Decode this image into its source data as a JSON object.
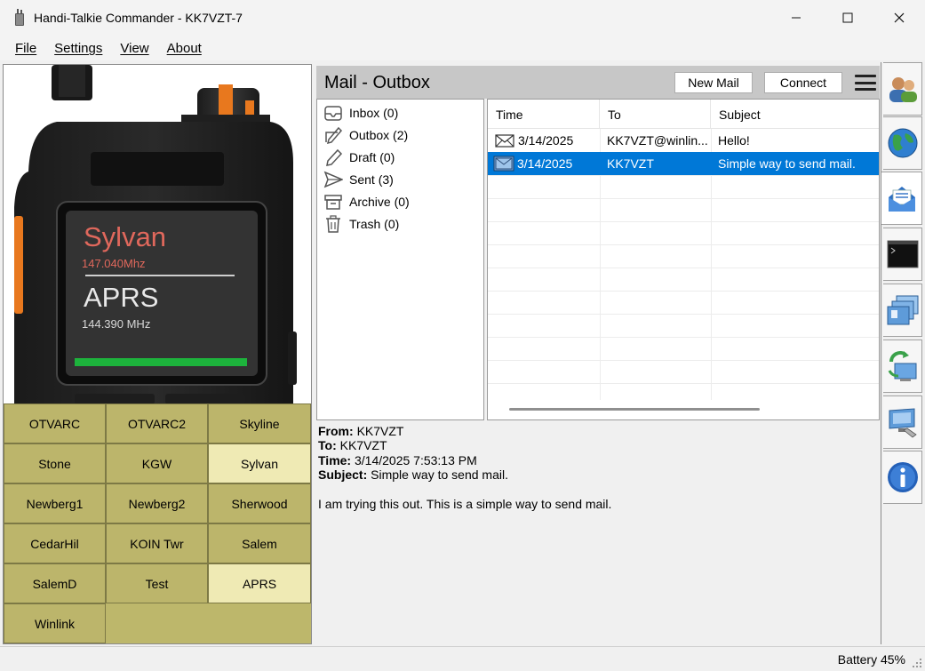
{
  "window": {
    "title": "Handi-Talkie Commander - KK7VZT-7"
  },
  "menu": [
    "File",
    "Settings",
    "View",
    "About"
  ],
  "radio": {
    "display_line1": "Sylvan",
    "display_freq1": "147.040Mhz",
    "display_line2": "APRS",
    "display_freq2": "144.390 MHz"
  },
  "channels": [
    {
      "label": "OTVARC",
      "active": false
    },
    {
      "label": "OTVARC2",
      "active": false
    },
    {
      "label": "Skyline",
      "active": false
    },
    {
      "label": "Stone",
      "active": false
    },
    {
      "label": "KGW",
      "active": false
    },
    {
      "label": "Sylvan",
      "active": true
    },
    {
      "label": "Newberg1",
      "active": false
    },
    {
      "label": "Newberg2",
      "active": false
    },
    {
      "label": "Sherwood",
      "active": false
    },
    {
      "label": "CedarHil",
      "active": false
    },
    {
      "label": "KOIN Twr",
      "active": false
    },
    {
      "label": "Salem",
      "active": false
    },
    {
      "label": "SalemD",
      "active": false
    },
    {
      "label": "Test",
      "active": false
    },
    {
      "label": "APRS",
      "active": true
    },
    {
      "label": "Winlink",
      "active": false
    }
  ],
  "mail": {
    "title": "Mail - Outbox",
    "new_mail_label": "New Mail",
    "connect_label": "Connect",
    "folders": [
      {
        "label": "Inbox (0)",
        "icon": "inbox-icon"
      },
      {
        "label": "Outbox (2)",
        "icon": "outbox-icon"
      },
      {
        "label": "Draft (0)",
        "icon": "draft-icon"
      },
      {
        "label": "Sent (3)",
        "icon": "sent-icon"
      },
      {
        "label": "Archive (0)",
        "icon": "archive-icon"
      },
      {
        "label": "Trash (0)",
        "icon": "trash-icon"
      }
    ],
    "columns": [
      "Time",
      "To",
      "Subject"
    ],
    "rows": [
      {
        "time": "3/14/2025",
        "to": "KK7VZT@winlin...",
        "subject": "Hello!",
        "selected": false
      },
      {
        "time": "3/14/2025",
        "to": "KK7VZT",
        "subject": "Simple way to send mail.",
        "selected": true
      }
    ],
    "preview": {
      "from_label": "From:",
      "from": "KK7VZT",
      "to_label": "To:",
      "to": "KK7VZT",
      "time_label": "Time:",
      "time": "3/14/2025 7:53:13 PM",
      "subject_label": "Subject:",
      "subject": "Simple way to send mail.",
      "body": "I am trying this out. This is a simple way to send mail."
    }
  },
  "side_tabs": [
    "contacts-icon",
    "globe-icon",
    "mail-icon",
    "terminal-icon",
    "windows-icon",
    "sync-icon",
    "computer-icon",
    "info-icon"
  ],
  "status": {
    "battery": "Battery 45%"
  },
  "colors": {
    "channel_bg": "#bcb56b",
    "channel_active": "#efeab4",
    "selection": "#0078d7",
    "display_red": "#e0685c"
  }
}
